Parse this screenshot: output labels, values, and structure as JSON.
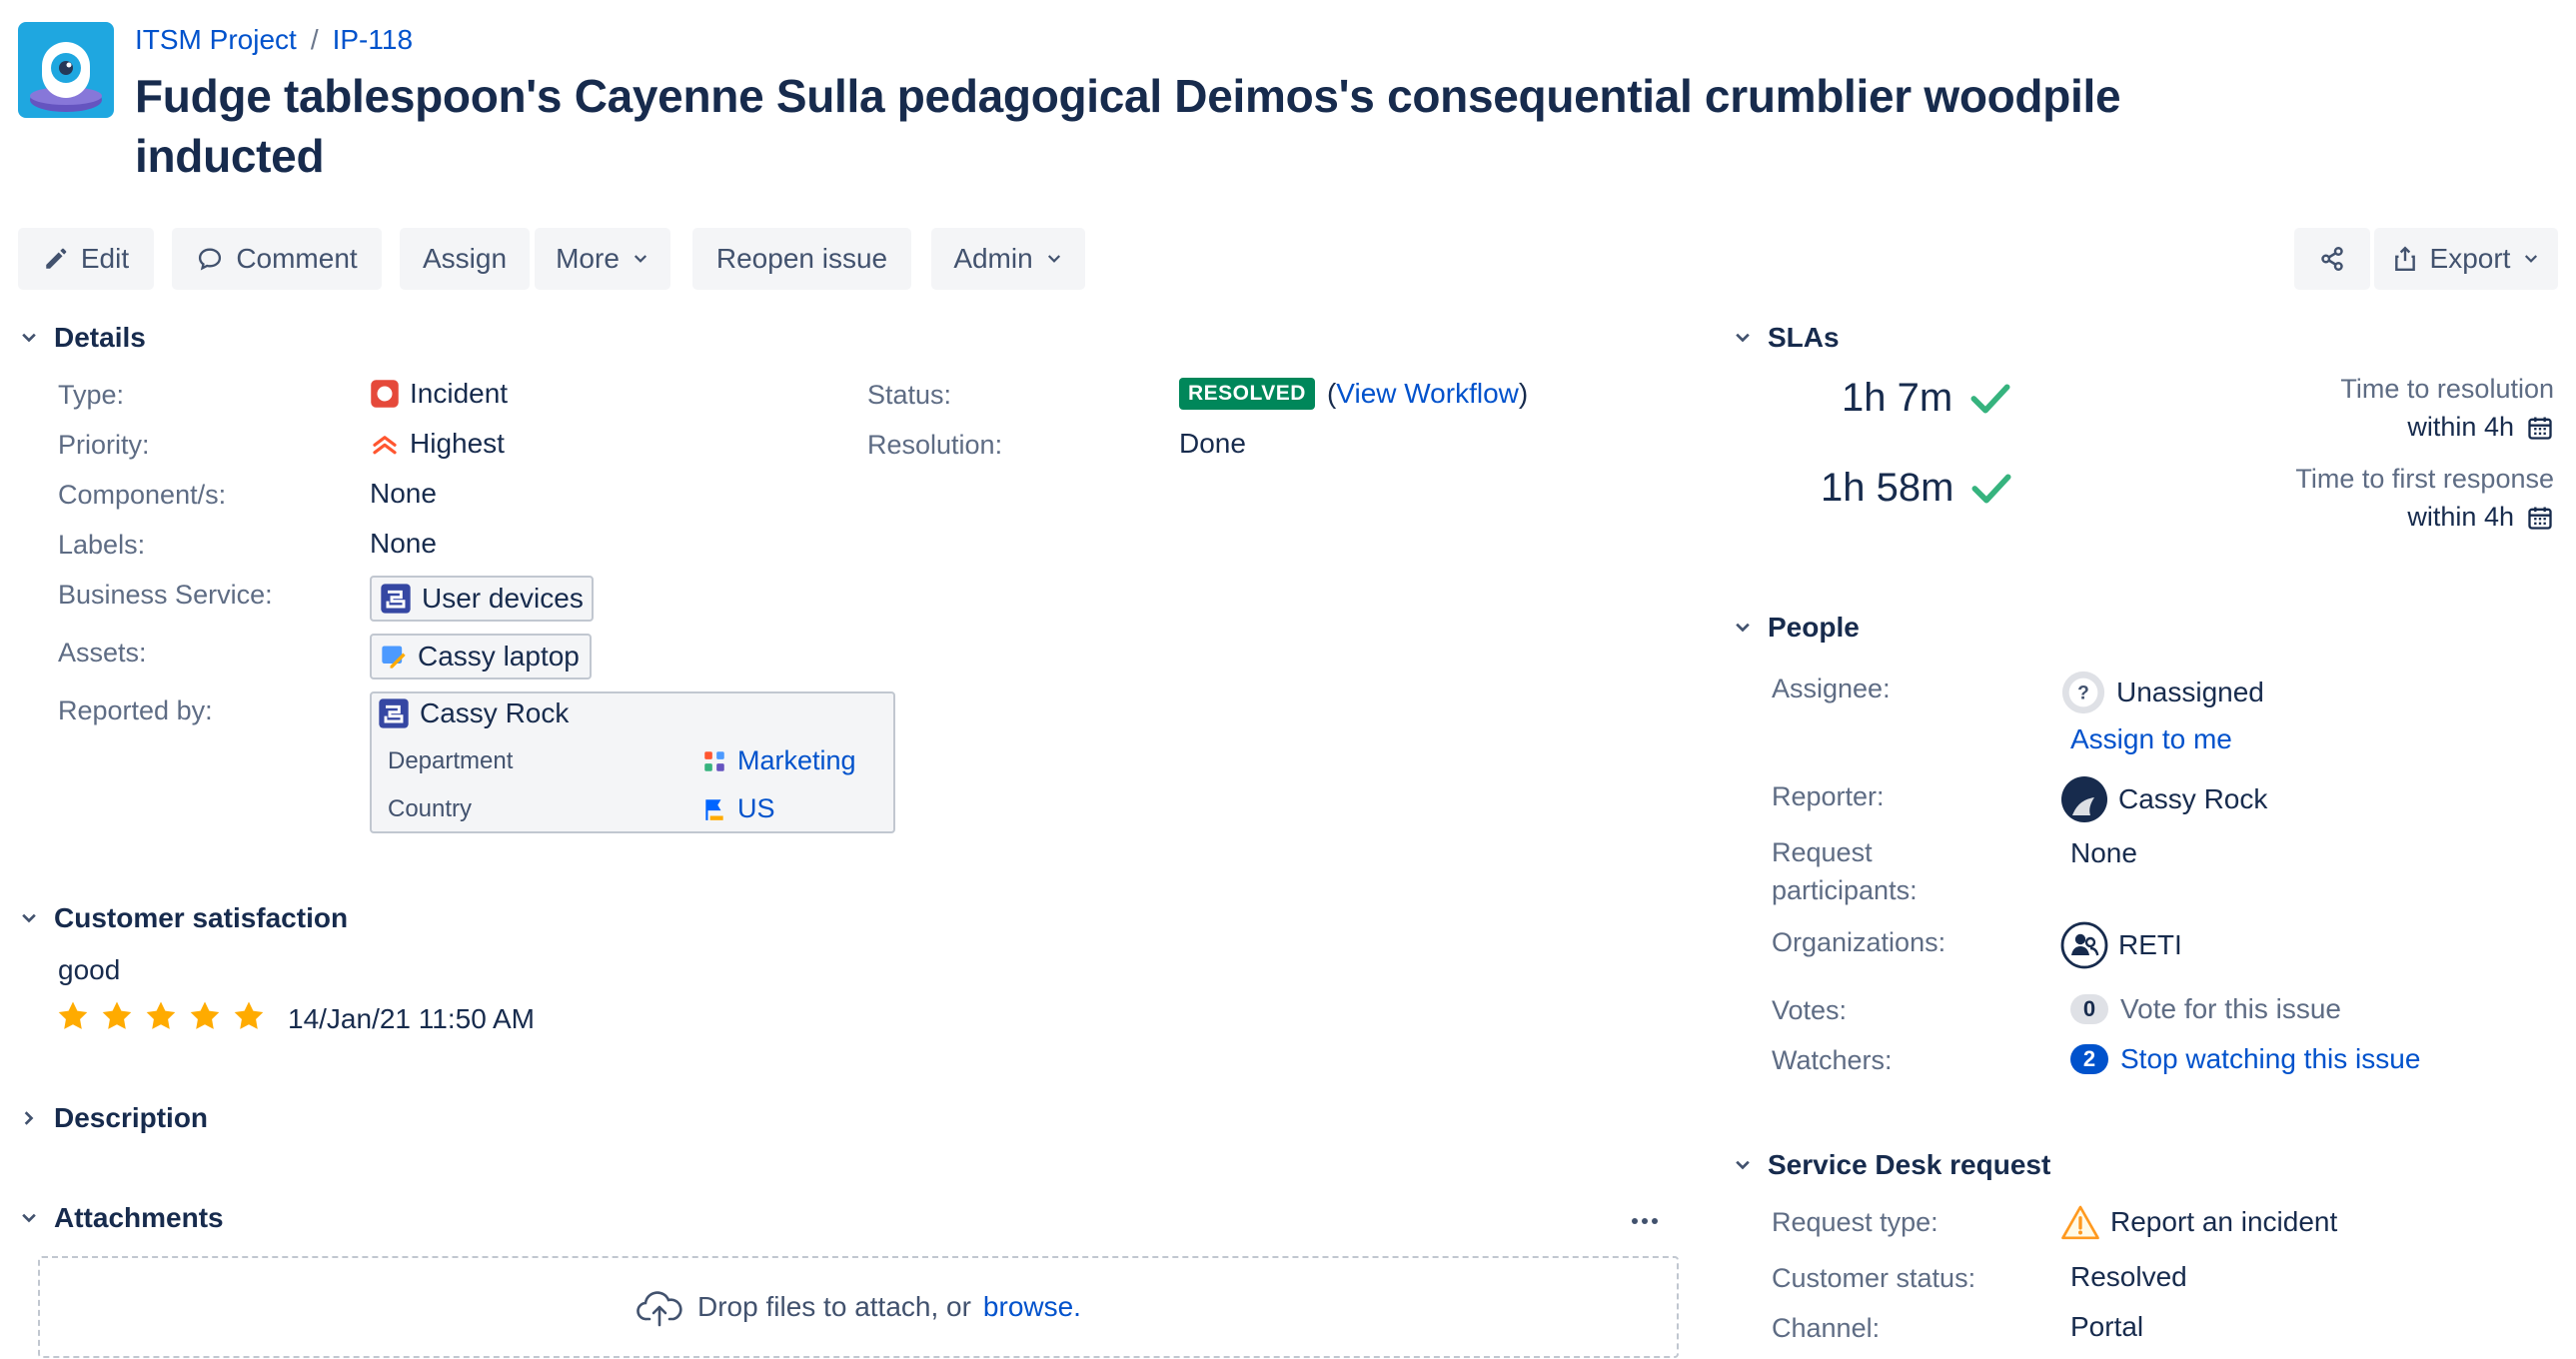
{
  "header": {
    "project": "ITSM Project",
    "separator": "/",
    "issue_key": "IP-118",
    "title": "Fudge tablespoon's Cayenne Sulla pedagogical Deimos's consequential crumblier woodpile inducted"
  },
  "toolbar": {
    "edit": "Edit",
    "comment": "Comment",
    "assign": "Assign",
    "more": "More",
    "reopen": "Reopen issue",
    "admin": "Admin",
    "export": "Export"
  },
  "details": {
    "heading": "Details",
    "type_label": "Type:",
    "type_value": "Incident",
    "priority_label": "Priority:",
    "priority_value": "Highest",
    "components_label": "Component/s:",
    "components_value": "None",
    "labels_label": "Labels:",
    "labels_value": "None",
    "business_service_label": "Business Service:",
    "business_service_value": "User devices",
    "assets_label": "Assets:",
    "assets_value": "Cassy laptop",
    "reported_by_label": "Reported by:",
    "reporter_name": "Cassy Rock",
    "department_label": "Department",
    "department_value": "Marketing",
    "country_label": "Country",
    "country_value": "US",
    "status_label": "Status:",
    "status_value": "RESOLVED",
    "view_workflow": "View Workflow",
    "paren_open": "(",
    "paren_close": ")",
    "resolution_label": "Resolution:",
    "resolution_value": "Done"
  },
  "satisfaction": {
    "heading": "Customer satisfaction",
    "rating_text": "good",
    "stars": 5,
    "date": "14/Jan/21 11:50 AM"
  },
  "description": {
    "heading": "Description"
  },
  "attachments": {
    "heading": "Attachments",
    "drop_text": "Drop files to attach, or",
    "browse": "browse."
  },
  "slas": {
    "heading": "SLAs",
    "items": [
      {
        "time": "1h 7m",
        "name": "Time to resolution",
        "within": "within 4h"
      },
      {
        "time": "1h 58m",
        "name": "Time to first response",
        "within": "within 4h"
      }
    ]
  },
  "people": {
    "heading": "People",
    "assignee_label": "Assignee:",
    "assignee_value": "Unassigned",
    "assign_to_me": "Assign to me",
    "reporter_label": "Reporter:",
    "reporter_value": "Cassy Rock",
    "participants_label_1": "Request",
    "participants_label_2": "participants:",
    "participants_value": "None",
    "organizations_label": "Organizations:",
    "organizations_value": "RETI",
    "votes_label": "Votes:",
    "votes_count": "0",
    "votes_text": "Vote for this issue",
    "watchers_label": "Watchers:",
    "watchers_count": "2",
    "watchers_text": "Stop watching this issue"
  },
  "service_desk": {
    "heading": "Service Desk request",
    "request_type_label": "Request type:",
    "request_type_value": "Report an incident",
    "customer_status_label": "Customer status:",
    "customer_status_value": "Resolved",
    "channel_label": "Channel:",
    "channel_value": "Portal"
  },
  "colors": {
    "link": "#0052cc",
    "resolved": "#00875a",
    "incident": "#e5493a",
    "priority": "#ff5630",
    "star": "#ffab00",
    "check": "#36b37e"
  }
}
